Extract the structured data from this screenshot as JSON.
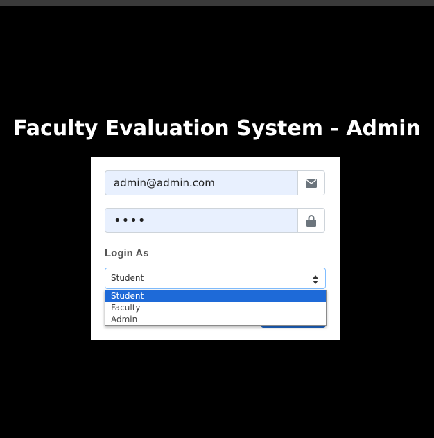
{
  "title": "Faculty Evaluation System - Admin",
  "email": {
    "value": "admin@admin.com",
    "icon": "envelope-icon"
  },
  "password": {
    "value": "••••",
    "icon": "lock-icon"
  },
  "login_as": {
    "label": "Login As",
    "selected": "Student",
    "options": [
      "Student",
      "Faculty",
      "Admin"
    ]
  },
  "colors": {
    "background": "#000000",
    "autofill": "#e8f0fe",
    "selected_option": "#1e6ad8"
  }
}
